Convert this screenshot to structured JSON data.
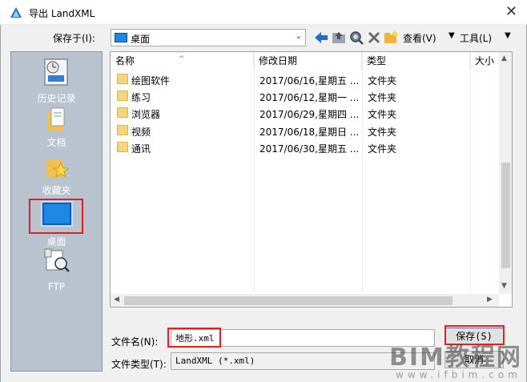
{
  "window": {
    "title": "导出 LandXML",
    "close_glyph": "✕"
  },
  "toolbar": {
    "save_in_label": "保存于(I):",
    "save_in_value": "桌面",
    "view_label": "查看(V)",
    "tools_label": "工具(L)",
    "icons": [
      "back-arrow-icon",
      "up-folder-icon",
      "search-web-icon",
      "delete-icon",
      "new-folder-icon"
    ]
  },
  "places": [
    {
      "label": "历史记录",
      "icon": "history-icon"
    },
    {
      "label": "文档",
      "icon": "documents-icon"
    },
    {
      "label": "收藏夹",
      "icon": "favorites-icon"
    },
    {
      "label": "桌面",
      "icon": "desktop-icon"
    },
    {
      "label": "FTP",
      "icon": "ftp-icon"
    }
  ],
  "file_list": {
    "columns": [
      "名称",
      "修改日期",
      "类型",
      "大小"
    ],
    "rows": [
      {
        "name": "绘图软件",
        "date": "2017/06/16,星期五 ...",
        "type": "文件夹"
      },
      {
        "name": "练习",
        "date": "2017/06/12,星期一 ...",
        "type": "文件夹"
      },
      {
        "name": "浏览器",
        "date": "2017/06/29,星期四 ...",
        "type": "文件夹"
      },
      {
        "name": "视频",
        "date": "2017/06/18,星期日 ...",
        "type": "文件夹"
      },
      {
        "name": "通讯",
        "date": "2017/06/30,星期五 ...",
        "type": "文件夹"
      }
    ]
  },
  "footer": {
    "filename_label": "文件名(N):",
    "filename_value": "地形.xml",
    "filetype_label": "文件类型(T):",
    "filetype_value": "LandXML (*.xml)",
    "save_button": "保存(S)",
    "cancel_button": "取消"
  },
  "watermark": {
    "big": "BIM教程网",
    "small": "www.ifbim.com"
  },
  "colors": {
    "highlight": "#e02020",
    "places_bg": "#b9c3cf",
    "folder": "#f7d57a"
  }
}
